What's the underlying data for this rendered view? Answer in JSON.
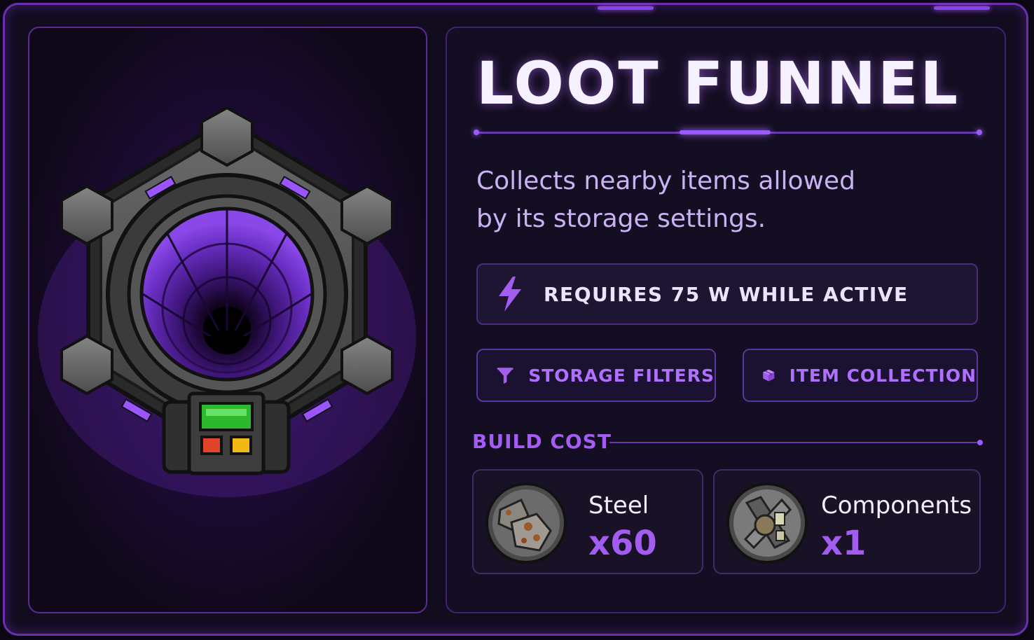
{
  "building": {
    "name": "LOOT FUNNEL",
    "description_line1": "Collects nearby items allowed",
    "description_line2": "by its storage settings.",
    "power": {
      "icon": "lightning-bolt-icon",
      "label": "REQUIRES 75 W WHILE ACTIVE"
    },
    "actions": [
      {
        "icon": "funnel-icon",
        "label": "STORAGE FILTERS"
      },
      {
        "icon": "box-icon",
        "label": "ITEM COLLECTION"
      }
    ],
    "build_cost": {
      "heading": "BUILD COST",
      "items": [
        {
          "icon": "steel-icon",
          "name": "Steel",
          "quantity": "x60"
        },
        {
          "icon": "components-icon",
          "name": "Components",
          "quantity": "x1"
        }
      ]
    }
  },
  "colors": {
    "accent": "#a35cf0",
    "frame": "#6a2fb3",
    "background": "#120c1f",
    "text": "#f6f1ff"
  }
}
